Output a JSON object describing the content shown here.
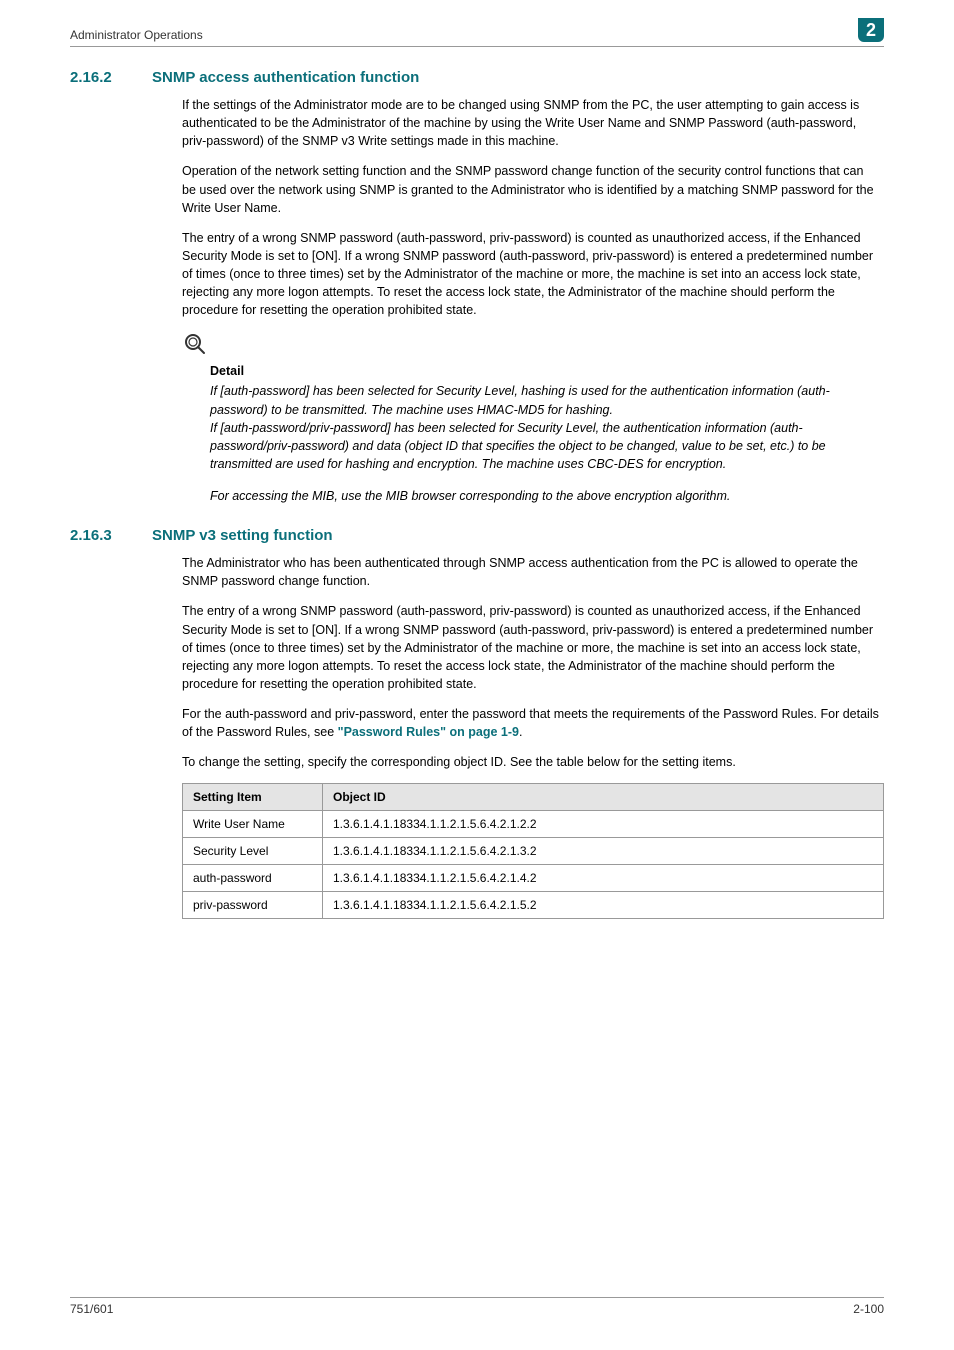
{
  "header": {
    "running_title": "Administrator Operations",
    "chapter_number": "2"
  },
  "section_2_16_2": {
    "number": "2.16.2",
    "title": "SNMP access authentication function",
    "p1": "If the settings of the Administrator mode are to be changed using SNMP from the PC, the user attempting to gain access is authenticated to be the Administrator of the machine by using the Write User Name and SNMP Password (auth-password, priv-password) of the SNMP v3 Write settings made in this machine.",
    "p2": "Operation of the network setting function and the SNMP password change function of the security control functions that can be used over the network using SNMP is granted to the Administrator who is identified by a matching SNMP password for the Write User Name.",
    "p3": "The entry of a wrong SNMP password (auth-password, priv-password) is counted as unauthorized access, if the Enhanced Security Mode is set to [ON]. If a wrong SNMP password (auth-password, priv-password) is entered a predetermined number of times (once to three times) set by the Administrator of the machine or more, the machine is set into an access lock state, rejecting any more logon attempts. To reset the access lock state, the Administrator of the machine should perform the procedure for resetting the operation prohibited state.",
    "detail_label": "Detail",
    "detail_body1": "If [auth-password] has been selected for Security Level, hashing is used for the authentication information (auth-password) to be transmitted. The machine uses HMAC-MD5 for hashing.\nIf [auth-password/priv-password] has been selected for Security Level, the authentication information (auth-password/priv-password) and data (object ID that specifies the object to be changed, value to be set, etc.) to be transmitted are used for hashing and encryption. The machine uses CBC-DES for encryption.",
    "detail_body2": "For accessing the MIB, use the MIB browser corresponding to the above encryption algorithm."
  },
  "section_2_16_3": {
    "number": "2.16.3",
    "title": "SNMP v3 setting function",
    "p1": "The Administrator who has been authenticated through SNMP access authentication from the PC is allowed to operate the SNMP password change function.",
    "p2": "The entry of a wrong SNMP password (auth-password, priv-password) is counted as unauthorized access, if the Enhanced Security Mode is set to [ON]. If a wrong SNMP password (auth-password, priv-password) is entered a predetermined number of times (once to three times) set by the Administrator of the machine or more, the machine is set into an access lock state, rejecting any more logon attempts. To reset the access lock state, the Administrator of the machine should perform the procedure for resetting the operation prohibited state.",
    "p3_pre": "For the auth-password and priv-password, enter the password that meets the requirements of the Password Rules. For details of the Password Rules, see ",
    "p3_link": "\"Password Rules\" on page 1-9",
    "p3_post": ".",
    "p4": "To change the setting, specify the corresponding object ID. See the table below for the setting items.",
    "table": {
      "headers": [
        "Setting Item",
        "Object ID"
      ],
      "rows": [
        [
          "Write User Name",
          "1.3.6.1.4.1.18334.1.1.2.1.5.6.4.2.1.2.2"
        ],
        [
          "Security Level",
          "1.3.6.1.4.1.18334.1.1.2.1.5.6.4.2.1.3.2"
        ],
        [
          "auth-password",
          "1.3.6.1.4.1.18334.1.1.2.1.5.6.4.2.1.4.2"
        ],
        [
          "priv-password",
          "1.3.6.1.4.1.18334.1.1.2.1.5.6.4.2.1.5.2"
        ]
      ]
    }
  },
  "footer": {
    "left": "751/601",
    "right": "2-100"
  }
}
